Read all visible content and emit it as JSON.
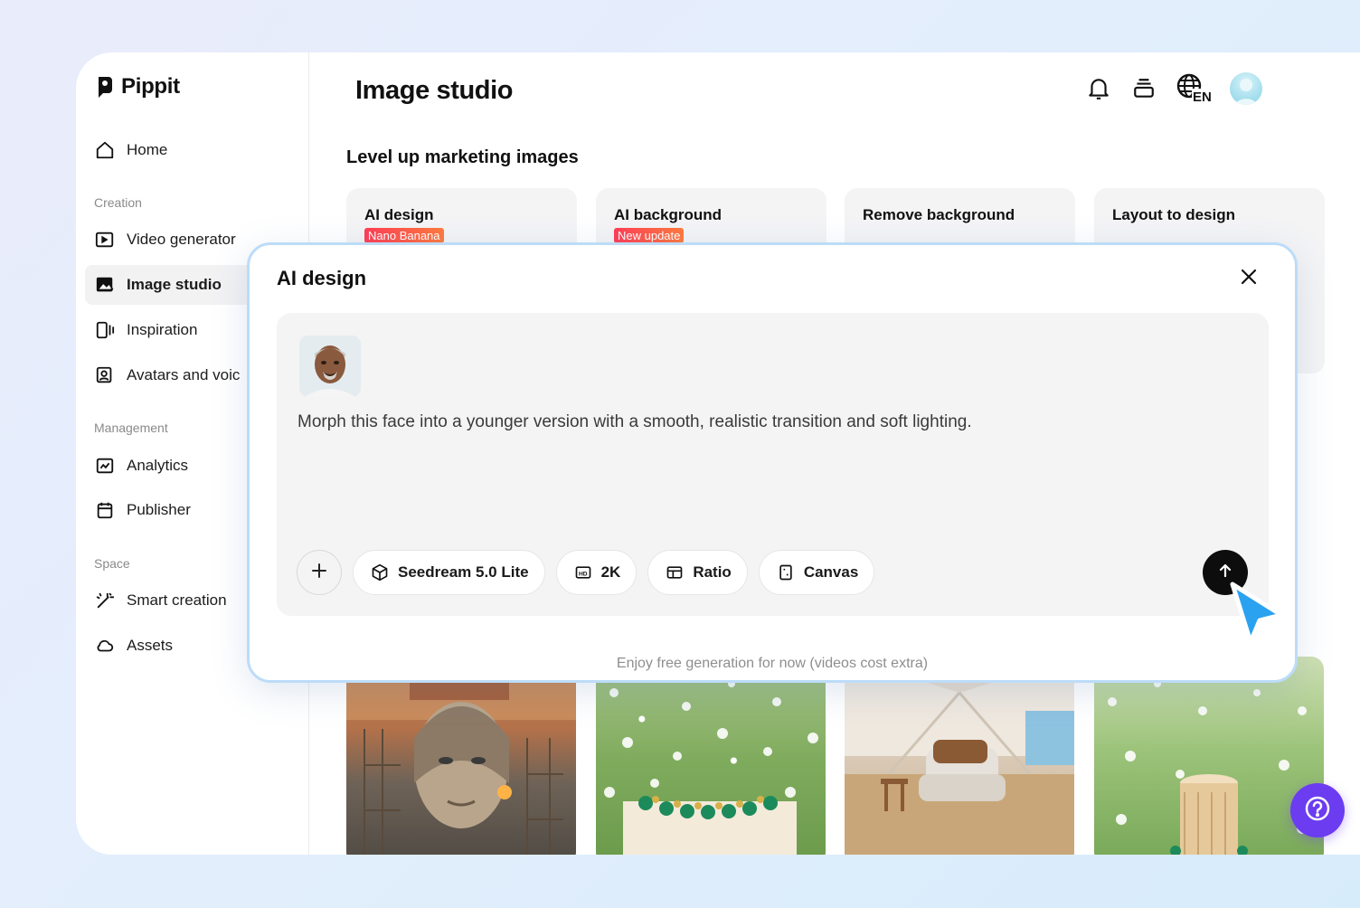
{
  "app": {
    "name": "Pippit"
  },
  "sidebar": {
    "home": "Home",
    "sections": {
      "creation": "Creation",
      "management": "Management",
      "space": "Space"
    },
    "items": [
      {
        "label": "Video generator",
        "icon": "video-plus-icon"
      },
      {
        "label": "Image studio",
        "icon": "image-spark-icon",
        "active": true
      },
      {
        "label": "Inspiration",
        "icon": "inspiration-icon"
      },
      {
        "label": "Avatars and voic",
        "icon": "avatar-icon"
      },
      {
        "label": "Analytics",
        "icon": "chart-icon"
      },
      {
        "label": "Publisher",
        "icon": "calendar-icon"
      },
      {
        "label": "Smart creation",
        "icon": "magic-wand-icon"
      },
      {
        "label": "Assets",
        "icon": "cloud-icon"
      }
    ]
  },
  "header": {
    "title": "Image studio",
    "language": "EN"
  },
  "main": {
    "section_title": "Level up marketing images",
    "cards": [
      {
        "title": "AI design",
        "badge": "Nano Banana"
      },
      {
        "title": "AI background",
        "badge": "New update"
      },
      {
        "title": "Remove background",
        "badge": ""
      },
      {
        "title": "Layout to design",
        "badge": ""
      }
    ]
  },
  "modal": {
    "title": "AI design",
    "prompt": "Morph this face into a younger version with a smooth, realistic transition and soft lighting.",
    "model": "Seedream 5.0 Lite",
    "resolution": "2K",
    "ratio": "Ratio",
    "canvas": "Canvas",
    "footer": "Enjoy free generation for now (videos cost extra)"
  },
  "colors": {
    "accent_help": "#6c3cf0",
    "badge": "#ff3d55",
    "modal_border": "#bcdcf8",
    "send": "#0d0d0d",
    "cursor": "#2aa2f0"
  }
}
